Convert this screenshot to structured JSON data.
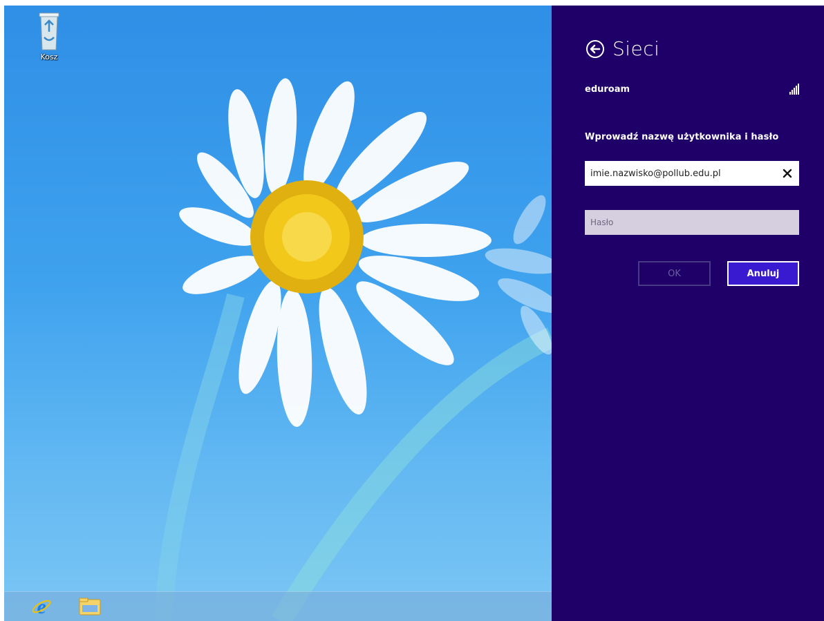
{
  "desktop": {
    "recycle_bin_label": "Kosz",
    "recycle_bin_icon": "recycle-bin-icon"
  },
  "taskbar": {
    "items": [
      {
        "name": "internet-explorer-icon"
      },
      {
        "name": "file-explorer-icon"
      }
    ]
  },
  "charm_panel": {
    "title": "Sieci",
    "back_icon": "back-arrow-icon",
    "network": {
      "name": "eduroam",
      "signal_icon": "wifi-signal-icon"
    },
    "prompt": "Wprowadź nazwę użytkownika i hasło",
    "username": {
      "value": "imie.nazwisko@pollub.edu.pl"
    },
    "password": {
      "placeholder": "Hasło"
    },
    "buttons": {
      "ok": "OK",
      "cancel": "Anuluj"
    },
    "colors": {
      "panel_bg": "#1f0068",
      "cancel_bg": "#3a1ad0"
    }
  }
}
